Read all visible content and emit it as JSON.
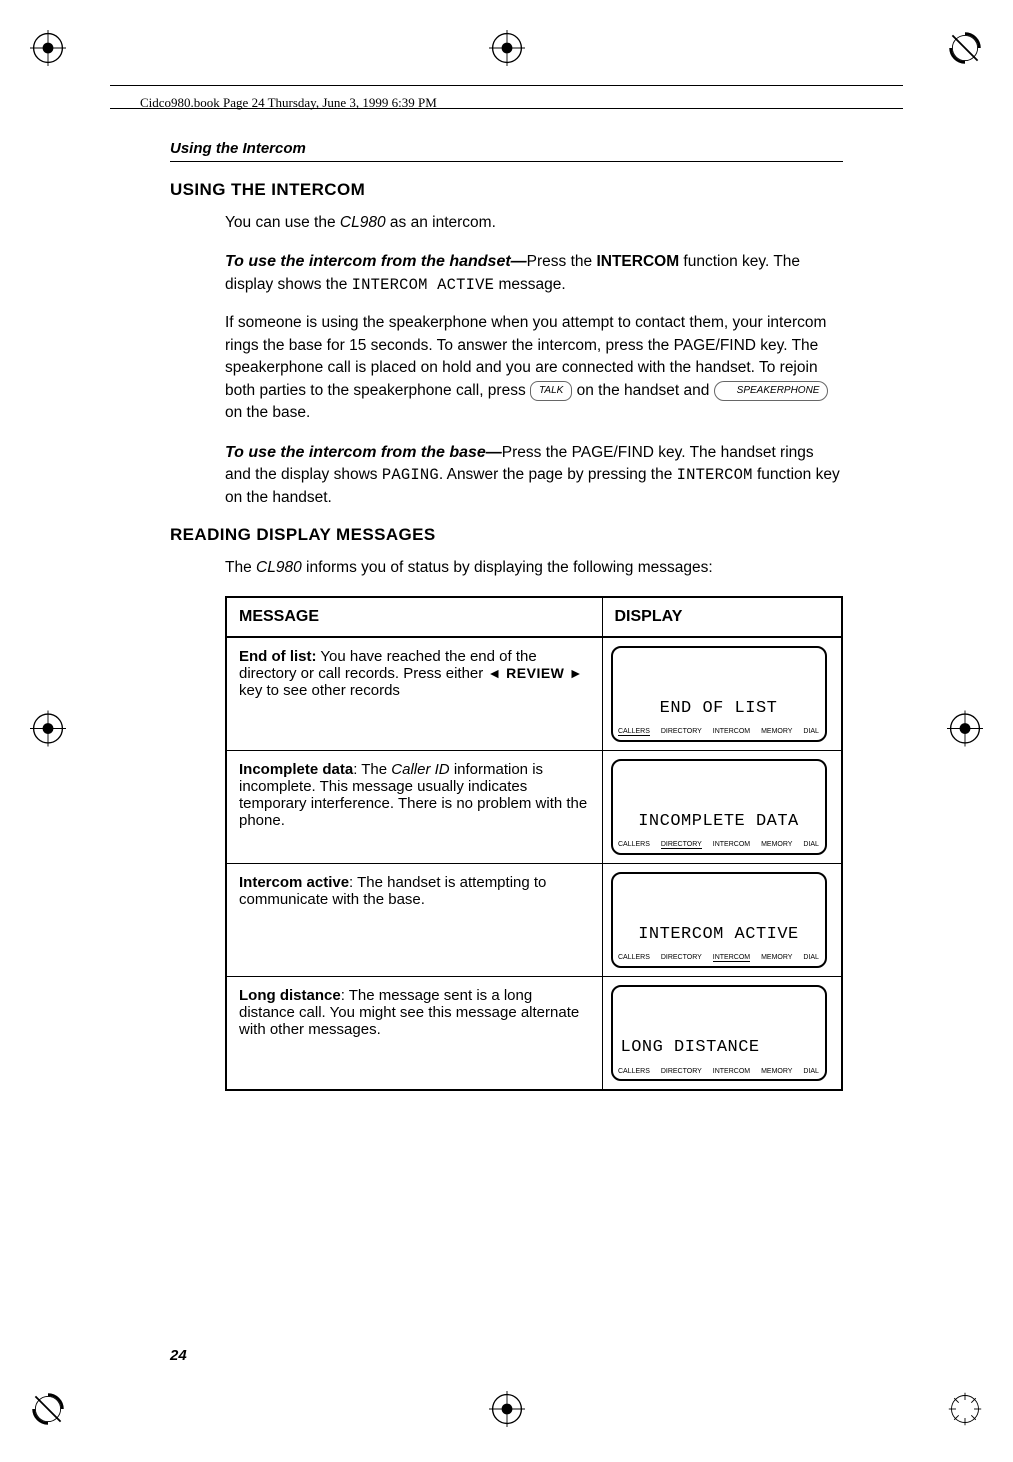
{
  "header_line": "Cidco980.book  Page 24  Thursday, June 3, 1999  6:39 PM",
  "running_head": "Using the Intercom",
  "section1_title": "USING THE INTERCOM",
  "p1_a": "You can use the ",
  "p1_model": "CL980",
  "p1_b": " as an intercom.",
  "p2_lead": "To use the intercom from the handset—",
  "p2_a": "Press the ",
  "p2_key": "INTERCOM",
  "p2_b": " function key. The display shows the ",
  "p2_lcd": "INTERCOM ACTIVE",
  "p2_c": " message.",
  "p3_a": "If someone is using the speakerphone when you attempt to contact them, your intercom rings the base for 15 seconds. To answer the intercom, press the PAGE/FIND key. The speakerphone call is placed on hold and you are connected with the handset. To rejoin both parties to the speakerphone call, press ",
  "talk_key": "TALK",
  "p3_b": " on the handset and ",
  "speaker_key": "SPEAKERPHONE",
  "p3_c": " on the base.",
  "p4_lead": "To use the intercom from the base—",
  "p4_a": "Press the PAGE/FIND key. The handset rings and the display shows ",
  "p4_lcd": "PAGING",
  "p4_b": ". Answer the page by pressing the ",
  "p4_lcd2": "INTERCOM",
  "p4_c": " function key on the handset.",
  "section2_title": "READING DISPLAY MESSAGES",
  "p5_a": "The ",
  "p5_model": "CL980",
  "p5_b": " informs you of status by displaying the following messages:",
  "table": {
    "col1": "MESSAGE",
    "col2": "DISPLAY",
    "rows": [
      {
        "strong": "End of list:",
        "msg_a": " You have reached the end of the directory or call records. Press either ",
        "review_key": "◄ REVIEW ►",
        "msg_b": " key to see other records",
        "display": "END OF LIST",
        "display_align": "center",
        "underline_idx": 0
      },
      {
        "strong": "Incomplete data",
        "msg_a": ": The ",
        "italic": "Caller ID",
        "msg_b": " information is incomplete. This message usually indicates temporary interference. There is no problem with the phone.",
        "display": "INCOMPLETE DATA",
        "display_align": "center",
        "underline_idx": 1
      },
      {
        "strong": "Intercom active",
        "msg_a": ": The handset is attempting to communicate with the base.",
        "msg_b": "",
        "display": "INTERCOM ACTIVE",
        "display_align": "center",
        "underline_idx": 2
      },
      {
        "strong": "Long distance",
        "msg_a": ": The message sent is a long distance call. You might see this message alternate with other messages.",
        "msg_b": "",
        "display": "LONG DISTANCE",
        "display_align": "left",
        "underline_idx": -1
      }
    ],
    "softkeys": [
      "CALLERS",
      "DIRECTORY",
      "INTERCOM",
      "MEMORY",
      "DIAL"
    ]
  },
  "page_num": "24"
}
